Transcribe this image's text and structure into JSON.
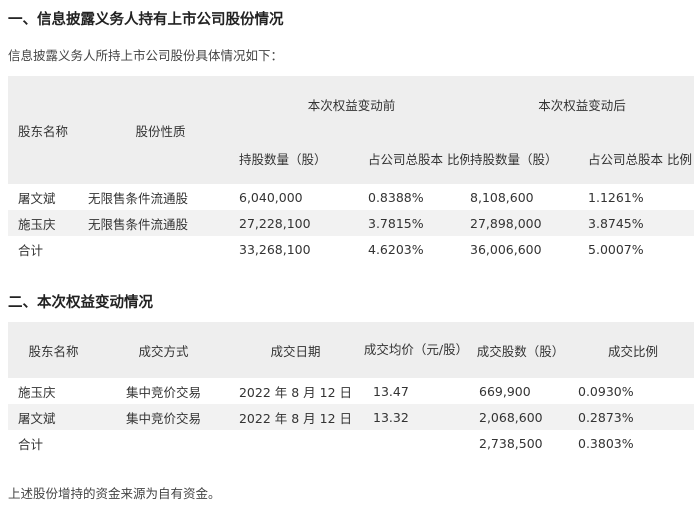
{
  "section1": {
    "title": "一、信息披露义务人持有上市公司股份情况",
    "intro": "信息披露义务人所持上市公司股份具体情况如下：",
    "table": {
      "col_shareholder": "股东名称",
      "col_nature": "股份性质",
      "group_before": "本次权益变动前",
      "group_after": "本次权益变动后",
      "sub_qty_before": "持股数量（股）",
      "sub_ratio_before": "占公司总股本 比例",
      "sub_qty_after": "持股数量（股）",
      "sub_ratio_after": "占公司总股本 比例",
      "rows": [
        {
          "name": "屠文斌",
          "nature": "无限售条件流通股",
          "qty_before": "6,040,000",
          "ratio_before": "0.8388%",
          "qty_after": "8,108,600",
          "ratio_after": "1.1261%"
        },
        {
          "name": "施玉庆",
          "nature": "无限售条件流通股",
          "qty_before": "27,228,100",
          "ratio_before": "3.7815%",
          "qty_after": "27,898,000",
          "ratio_after": "3.8745%"
        }
      ],
      "total": {
        "label": "合计",
        "qty_before": "33,268,100",
        "ratio_before": "4.6203%",
        "qty_after": "36,006,600",
        "ratio_after": "5.0007%"
      }
    }
  },
  "section2": {
    "title": "二、本次权益变动情况",
    "table": {
      "col_shareholder": "股东名称",
      "col_method": "成交方式",
      "col_date": "成交日期",
      "col_price": "成交均价（元/股）",
      "col_shares": "成交股数（股）",
      "col_ratio": "成交比例",
      "rows": [
        {
          "name": "施玉庆",
          "method": "集中竞价交易",
          "date": "2022 年 8 月 12 日",
          "price": "13.47",
          "shares": "669,900",
          "ratio": "0.0930%"
        },
        {
          "name": "屠文斌",
          "method": "集中竞价交易",
          "date": "2022 年 8 月 12 日",
          "price": "13.32",
          "shares": "2,068,600",
          "ratio": "0.2873%"
        }
      ],
      "total": {
        "label": "合计",
        "shares": "2,738,500",
        "ratio": "0.3803%"
      }
    }
  },
  "footer_note": "上述股份增持的资金来源为自有资金。"
}
